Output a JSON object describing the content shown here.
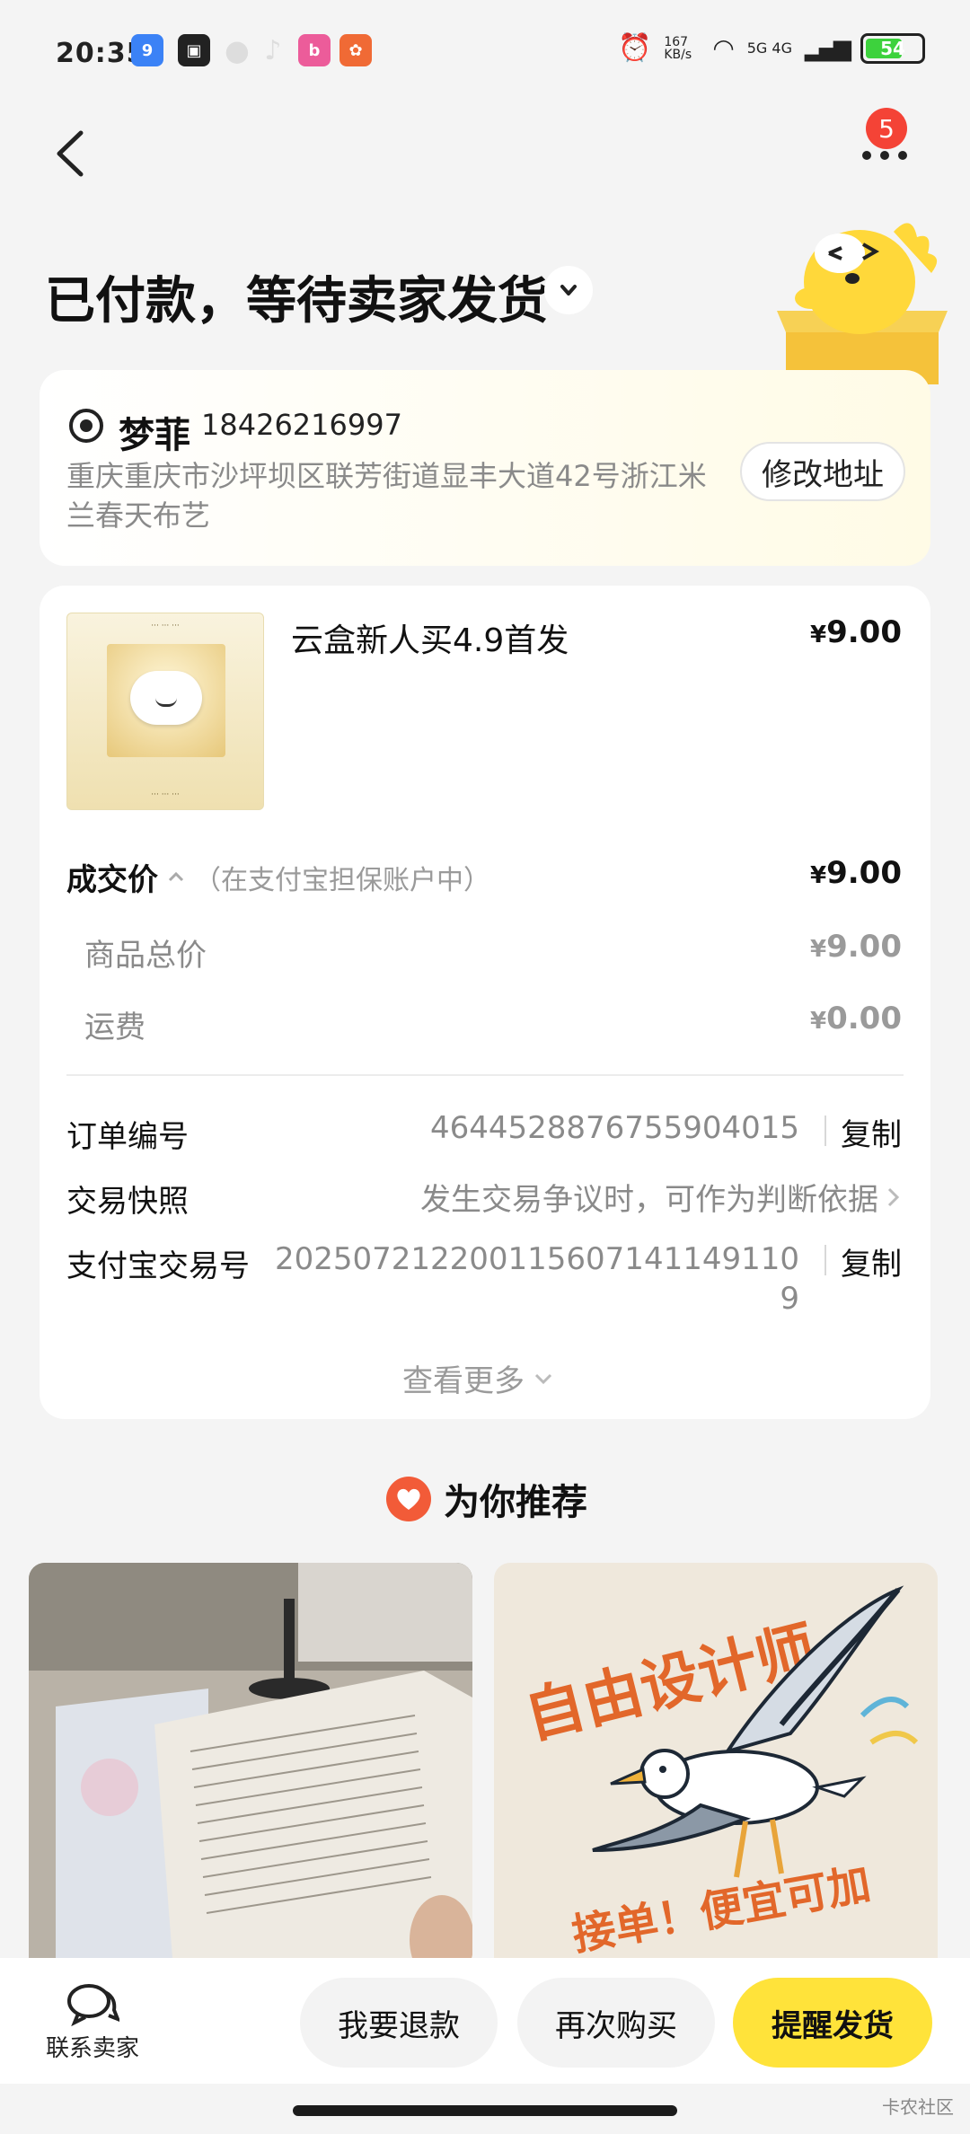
{
  "status_bar": {
    "time": "20:35",
    "net_speed": "167 KB/s",
    "signal": "5G 4G",
    "battery": "54"
  },
  "header": {
    "more_badge": "5",
    "title": "已付款，等待卖家发货"
  },
  "address": {
    "name": "梦菲",
    "phone": "18426216997",
    "detail": "重庆重庆市沙坪坝区联芳街道显丰大道42号浙江米兰春天布艺",
    "edit_button": "修改地址"
  },
  "product": {
    "title": "云盒新人买4.9首发",
    "price": "9.00"
  },
  "pricing": {
    "deal_label": "成交价",
    "deal_note": "（在支付宝担保账户中）",
    "deal_price": "9.00",
    "items": [
      {
        "label": "商品总价",
        "value": "9.00"
      },
      {
        "label": "运费",
        "value": "0.00"
      }
    ]
  },
  "order_info": {
    "order_no_label": "订单编号",
    "order_no": "4644528876755904015",
    "snapshot_label": "交易快照",
    "snapshot_value": "发生交易争议时，可作为判断依据",
    "alipay_label": "支付宝交易号",
    "alipay_no_line1": "202507212200115607141149110",
    "alipay_no_line2": "9",
    "copy": "复制",
    "view_more": "查看更多"
  },
  "recommend": {
    "title": "为你推荐",
    "card2_text1": "自由设计师",
    "card2_text2": "接单！便宜可加急！"
  },
  "bottom_bar": {
    "contact": "联系卖家",
    "refund": "我要退款",
    "rebuy": "再次购买",
    "remind": "提醒发货"
  },
  "watermark": "卡农社区",
  "colors": {
    "accent_yellow": "#ffe33a",
    "badge_red": "#f44336",
    "heart_orange": "#f25b38"
  }
}
